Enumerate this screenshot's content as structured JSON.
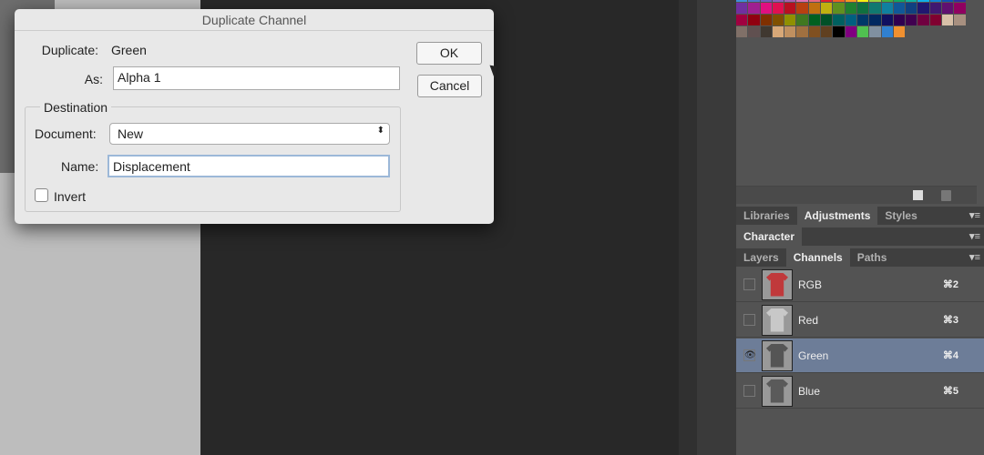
{
  "dialog": {
    "title": "Duplicate Channel",
    "duplicate_label": "Duplicate:",
    "duplicate_value": "Green",
    "as_label": "As:",
    "as_value": "Alpha 1",
    "destination_label": "Destination",
    "document_label": "Document:",
    "document_value": "New",
    "name_label": "Name:",
    "name_value": "Displacement",
    "invert_label": "Invert",
    "invert_checked": false,
    "ok_label": "OK",
    "cancel_label": "Cancel"
  },
  "swatches": [
    "#3f8fd8",
    "#4f74c8",
    "#6f5fb8",
    "#8f5fb8",
    "#a860b0",
    "#e070b0",
    "#e86880",
    "#e02030",
    "#f06020",
    "#f89820",
    "#f8f010",
    "#98d040",
    "#40b040",
    "#10a860",
    "#10b0a0",
    "#10b0e8",
    "#1080d0",
    "#1050b0",
    "#3030a0",
    "#7030a0",
    "#a02090",
    "#e01080",
    "#e01050",
    "#b81020",
    "#b84010",
    "#c07010",
    "#c0b010",
    "#609020",
    "#208030",
    "#107040",
    "#107870",
    "#1080a0",
    "#105898",
    "#104080",
    "#201870",
    "#401870",
    "#601070",
    "#900060",
    "#a00040",
    "#900010",
    "#803000",
    "#805000",
    "#909000",
    "#407820",
    "#006020",
    "#005028",
    "#006060",
    "#006080",
    "#003868",
    "#002860",
    "#101060",
    "#300050",
    "#400050",
    "#700040",
    "#800030",
    "#d8c0a8",
    "#a89080",
    "#807068",
    "#605050",
    "#403830",
    "#d8a878",
    "#c09060",
    "#a07040",
    "#805020",
    "#604020",
    "#000000",
    "#800080",
    "#50c050",
    "#8090a0",
    "#3080d0",
    "#f09030"
  ],
  "panel_tabs_1": [
    "Libraries",
    "Adjustments",
    "Styles"
  ],
  "panel_tabs_2": [
    "Character"
  ],
  "panel_tabs_3": [
    "Layers",
    "Channels",
    "Paths"
  ],
  "channels": [
    {
      "name": "RGB",
      "shortcut": "⌘2",
      "visible": false,
      "thumb": "#c0393b"
    },
    {
      "name": "Red",
      "shortcut": "⌘3",
      "visible": false,
      "thumb": "#c8c8c8"
    },
    {
      "name": "Green",
      "shortcut": "⌘4",
      "visible": true,
      "selected": true,
      "thumb": "#555555"
    },
    {
      "name": "Blue",
      "shortcut": "⌘5",
      "visible": false,
      "thumb": "#5a5a5a"
    }
  ]
}
